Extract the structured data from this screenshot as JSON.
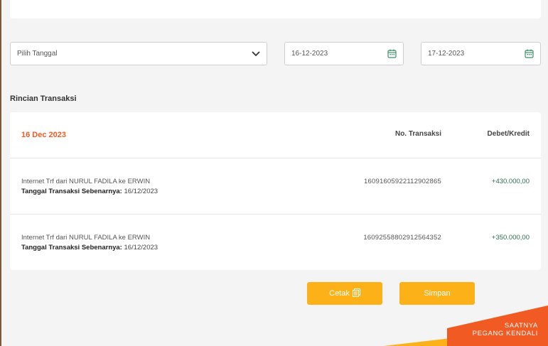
{
  "filters": {
    "period_select": "Pilih Tanggal",
    "start_date": "16-12-2023",
    "end_date": "17-12-2023"
  },
  "section_title": "Rincian Transaksi",
  "table": {
    "date_heading": "16 Dec 2023",
    "col_number": "No. Transaksi",
    "col_amount": "Debet/Kredit",
    "rows": [
      {
        "description": "Internet Trf dari NURUL FADILA ke ERWIN",
        "actual_date_label": "Tanggal Transaksi Sebenarnya:",
        "actual_date": "16/12/2023",
        "number": "16091605922112902865",
        "amount": "+430.000,00"
      },
      {
        "description": "Internet Trf dari NURUL FADILA ke ERWIN",
        "actual_date_label": "Tanggal Transaksi Sebenarnya:",
        "actual_date": "16/12/2023",
        "number": "16092558802912564352",
        "amount": "+350.000,00"
      }
    ]
  },
  "buttons": {
    "print": "Cetak",
    "save": "Simpan"
  },
  "promo": {
    "line1": "SAATNYA",
    "line2": "PEGANG KENDALI"
  },
  "colors": {
    "accent_orange": "#f15a22",
    "button_yellow": "#fbb117",
    "credit_green": "#2e6b4f"
  },
  "icons": {
    "select_arrow": "chevron-down-icon",
    "date_picker": "calendar-icon",
    "print": "document-icon"
  }
}
